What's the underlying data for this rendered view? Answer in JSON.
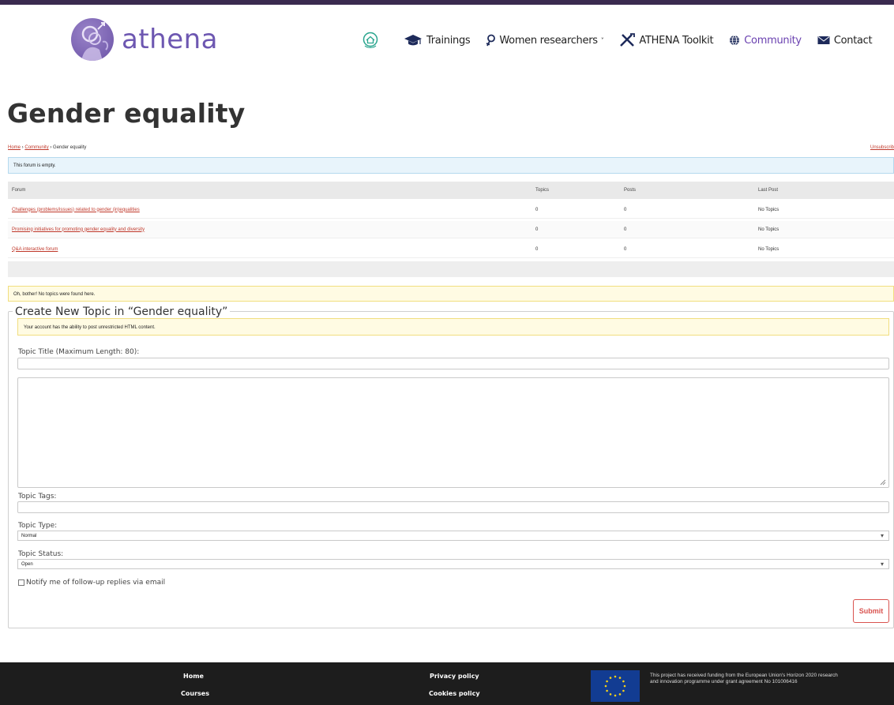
{
  "header": {
    "logo_text": "athena",
    "nav": [
      {
        "label": "Trainings",
        "icon": "graduation-cap-icon"
      },
      {
        "label": "Women researchers",
        "icon": "female-symbol-icon"
      },
      {
        "label": "ATHENA Toolkit",
        "icon": "tools-icon"
      },
      {
        "label": "Community",
        "icon": "globe-icon",
        "active": true
      },
      {
        "label": "Contact",
        "icon": "envelope-icon"
      }
    ],
    "accent_color": "#6a41b0"
  },
  "page": {
    "title": "Gender equality",
    "breadcrumb": {
      "home": "Home",
      "sep1": " › ",
      "community": "Community",
      "sep2": " › ",
      "current": "Gender equality"
    },
    "unsubscribe": "Unsubscrib",
    "empty_notice": "This forum is empty."
  },
  "forum_table": {
    "headers": {
      "forum": "Forum",
      "topics": "Topics",
      "posts": "Posts",
      "last_post": "Last Post"
    },
    "rows": [
      {
        "forum": "Challenges (problems/issues) related to gender (in)equalities",
        "topics": "0",
        "posts": "0",
        "last_post": "No Topics"
      },
      {
        "forum": "Promising initiatives for promoting gender equality and diversity",
        "topics": "0",
        "posts": "0",
        "last_post": "No Topics"
      },
      {
        "forum": "Q&A interactive forum",
        "topics": "0",
        "posts": "0",
        "last_post": "No Topics"
      }
    ]
  },
  "no_topics_notice": "Oh, bother! No topics were found here.",
  "new_topic": {
    "legend": "Create New Topic in “Gender equality”",
    "html_notice": "Your account has the ability to post unrestricted HTML content.",
    "title_label": "Topic Title (Maximum Length: 80):",
    "title_value": "",
    "content_value": "",
    "tags_label": "Topic Tags:",
    "tags_value": "",
    "type_label": "Topic Type:",
    "type_value": "Normal",
    "status_label": "Topic Status:",
    "status_value": "Open",
    "notify_label": "Notify me of follow-up replies via email",
    "submit_label": "Submit"
  },
  "footer": {
    "links_col1": [
      "Home",
      "Courses"
    ],
    "links_col2": [
      "Privacy policy",
      "Cookies policy"
    ],
    "eu_text": "This project has received funding from the European Union's Horizon 2020 research and innovation programme under grant agreement No 101006416"
  }
}
